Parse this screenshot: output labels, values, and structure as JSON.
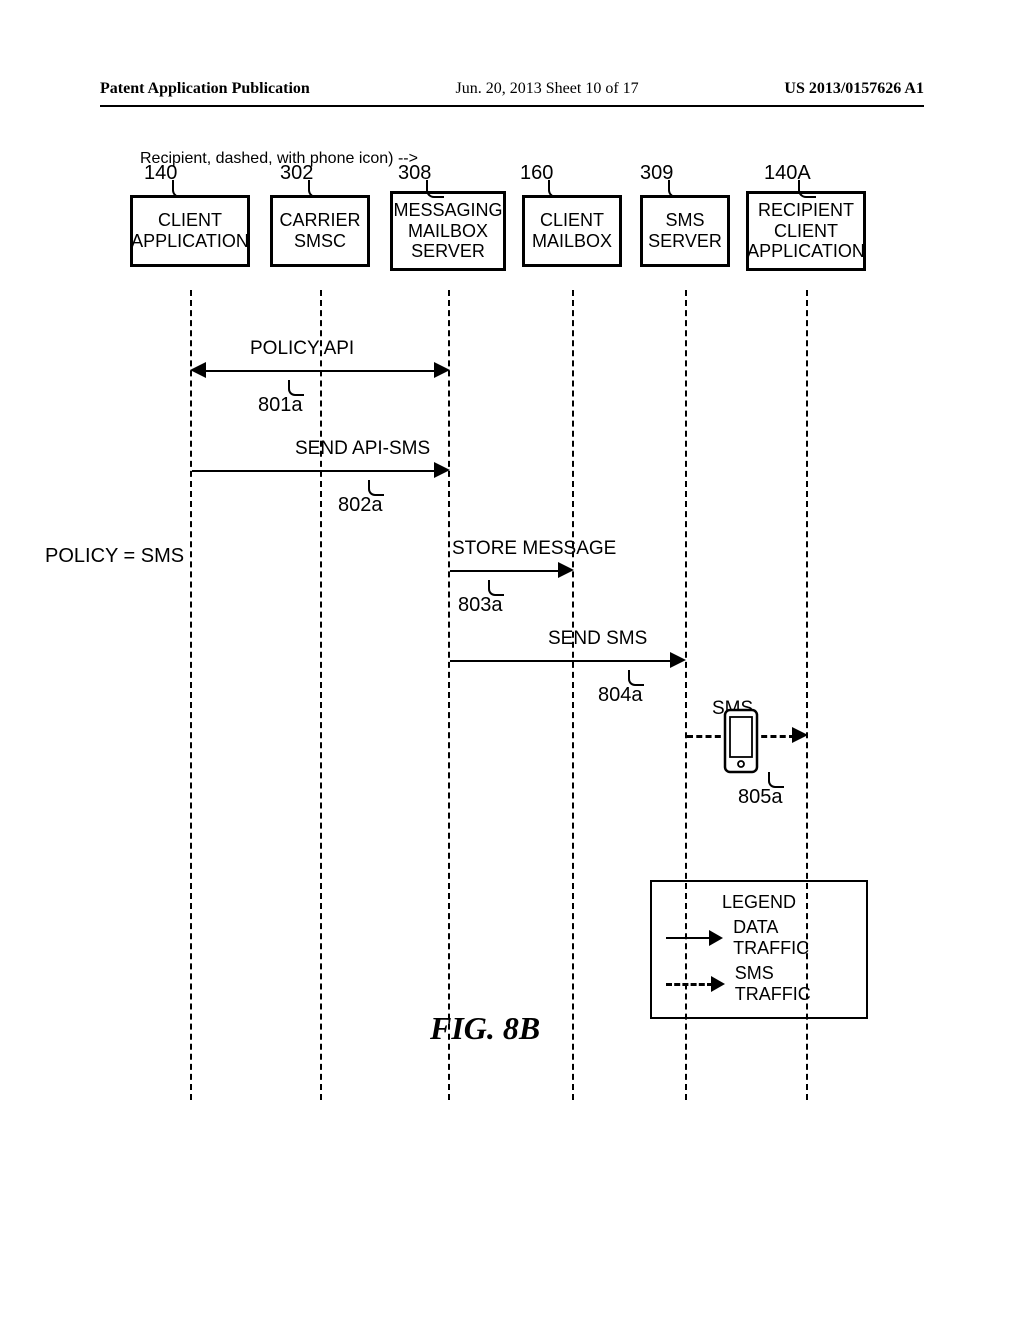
{
  "header": {
    "left": "Patent Application Publication",
    "mid": "Jun. 20, 2013  Sheet 10 of 17",
    "right": "US 2013/0157626 A1"
  },
  "actors": {
    "a1": {
      "ref": "140",
      "label": "CLIENT\nAPPLICATION"
    },
    "a2": {
      "ref": "302",
      "label": "CARRIER\nSMSC"
    },
    "a3": {
      "ref": "308",
      "label": "MESSAGING\nMAILBOX\nSERVER"
    },
    "a4": {
      "ref": "160",
      "label": "CLIENT\nMAILBOX"
    },
    "a5": {
      "ref": "309",
      "label": "SMS\nSERVER"
    },
    "a6": {
      "ref": "140A",
      "label": "RECIPIENT\nCLIENT\nAPPLICATION"
    }
  },
  "messages": {
    "m1": {
      "ref": "801a",
      "label": "POLICY API"
    },
    "m2": {
      "ref": "802a",
      "label": "SEND API-SMS"
    },
    "m3": {
      "ref": "803a",
      "label": "STORE MESSAGE"
    },
    "m4": {
      "ref": "804a",
      "label": "SEND SMS"
    },
    "m5": {
      "ref": "805a",
      "label": "SMS"
    }
  },
  "policy": "POLICY = SMS",
  "figure": "FIG. 8B",
  "legend": {
    "title": "LEGEND",
    "row1": "DATA TRAFFIC",
    "row2": "SMS TRAFFIC"
  }
}
